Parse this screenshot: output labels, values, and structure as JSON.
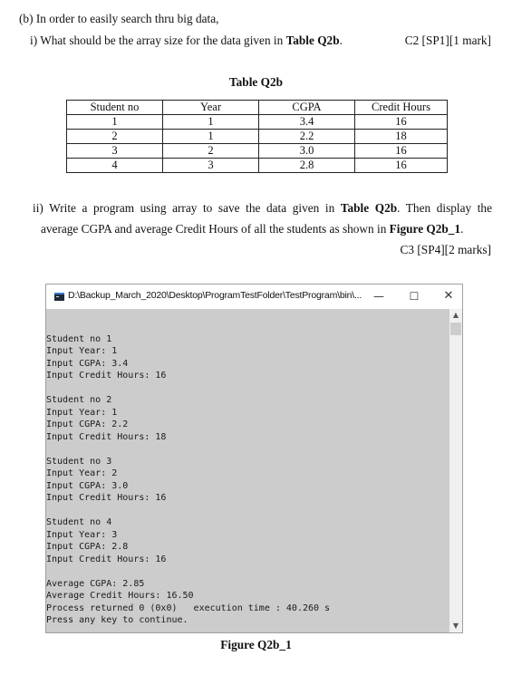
{
  "question_b": {
    "intro": "(b) In order to easily search thru big data,",
    "part_i": {
      "prefix": "i) What should be the array size for the data given in ",
      "ref": "Table Q2b",
      "suffix": ".",
      "marks": "C2 [SP1][1 mark]"
    },
    "table": {
      "title": "Table Q2b",
      "headers": [
        "Student no",
        "Year",
        "CGPA",
        "Credit Hours"
      ],
      "rows": [
        [
          "1",
          "1",
          "3.4",
          "16"
        ],
        [
          "2",
          "1",
          "2.2",
          "18"
        ],
        [
          "3",
          "2",
          "3.0",
          "16"
        ],
        [
          "4",
          "3",
          "2.8",
          "16"
        ]
      ]
    },
    "part_ii": {
      "line1_prefix": "ii) Write a program using array to save the data given in ",
      "line1_ref": "Table Q2b",
      "line1_suffix": ". Then display the",
      "line2_prefix": "average CGPA and average Credit Hours of all the students as shown in ",
      "line2_ref": "Figure Q2b_1",
      "line2_suffix": ".",
      "marks": "C3 [SP4][2 marks]"
    }
  },
  "console_window": {
    "title": "D:\\Backup_March_2020\\Desktop\\ProgramTestFolder\\TestProgram\\bin\\...",
    "controls": {
      "minimize": "—",
      "maximize": "☐",
      "close": "✕"
    },
    "scroll_up": "^",
    "scroll_down": "v",
    "lines": [
      "",
      "Student no 1",
      "Input Year: 1",
      "Input CGPA: 3.4",
      "Input Credit Hours: 16",
      "",
      "Student no 2",
      "Input Year: 1",
      "Input CGPA: 2.2",
      "Input Credit Hours: 18",
      "",
      "Student no 3",
      "Input Year: 2",
      "Input CGPA: 3.0",
      "Input Credit Hours: 16",
      "",
      "Student no 4",
      "Input Year: 3",
      "Input CGPA: 2.8",
      "Input Credit Hours: 16",
      "",
      "Average CGPA: 2.85",
      "Average Credit Hours: 16.50",
      "Process returned 0 (0x0)   execution time : 40.260 s",
      "Press any key to continue."
    ]
  },
  "figure_caption": "Figure Q2b_1"
}
